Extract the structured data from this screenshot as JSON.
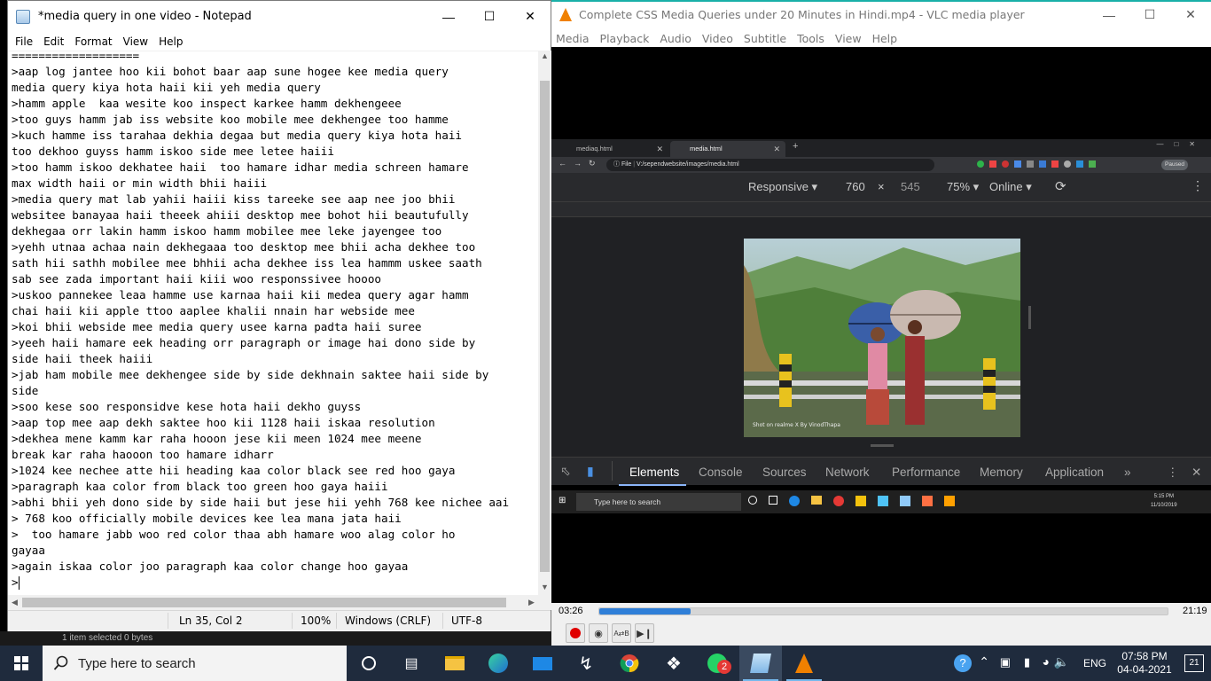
{
  "notepad": {
    "title": "*media query in one video - Notepad",
    "menu": [
      "File",
      "Edit",
      "Format",
      "View",
      "Help"
    ],
    "lines": [
      "===================",
      ">aap log jantee hoo kii bohot baar aap sune hogee kee media query",
      "media query kiya hota haii kii yeh media query",
      ">hamm apple  kaa wesite koo inspect karkee hamm dekhengeee",
      ">too guys hamm jab iss website koo mobile mee dekhengee too hamme",
      ">kuch hamme iss tarahaa dekhia degaa but media query kiya hota haii",
      "too dekhoo guyss hamm iskoo side mee letee haiii",
      ">too hamm iskoo dekhatee haii  too hamare idhar media schreen hamare",
      "max width haii or min width bhii haiii",
      ">media query mat lab yahii haiii kiss tareeke see aap nee joo bhii",
      "websitee banayaa haii theeek ahiii desktop mee bohot hii beautufully",
      "dekhegaa orr lakin hamm iskoo hamm mobilee mee leke jayengee too",
      ">yehh utnaa achaa nain dekhegaaa too desktop mee bhii acha dekhee too",
      "sath hii sathh mobilee mee bhhii acha dekhee iss lea hammm uskee saath",
      "sab see zada important haii kiii woo responssivee hoooo",
      ">uskoo pannekee leaa hamme use karnaa haii kii medea query agar hamm",
      "chai haii kii apple ttoo aaplee khalii nnain har webside mee",
      ">koi bhii webside mee media query usee karna padta haii suree",
      ">yeeh haii hamare eek heading orr paragraph or image hai dono side by",
      "side haii theek haiii",
      ">jab ham mobile mee dekhengee side by side dekhnain saktee haii side by",
      "side",
      ">soo kese soo responsidve kese hota haii dekho guyss",
      ">aap top mee aap dekh saktee hoo kii 1128 haii iskaa resolution",
      ">dekhea mene kamm kar raha hooon jese kii meen 1024 mee meene",
      "break kar raha haooon too hamare idharr",
      ">1024 kee nechee atte hii heading kaa color black see red hoo gaya",
      ">paragraph kaa color from black too green hoo gaya haiii",
      ">abhi bhii yeh dono side by side haii but jese hii yehh 768 kee nichee aai",
      "> 768 koo officially mobile devices kee lea mana jata haii",
      ">  too hamare jabb woo red color thaa abh hamare woo alag color ho",
      "gayaa",
      ">again iskaa color joo paragraph kaa color change hoo gayaa",
      ">"
    ],
    "status": {
      "position": "Ln 35, Col 2",
      "zoom": "100%",
      "line_ending": "Windows (CRLF)",
      "encoding": "UTF-8"
    }
  },
  "under_strip_text": "1 item selected  0 bytes",
  "vlc": {
    "title": "Complete CSS Media Queries under 20 Minutes in Hindi.mp4 - VLC media player",
    "menu": [
      "Media",
      "Playback",
      "Audio",
      "Video",
      "Subtitle",
      "Tools",
      "View",
      "Help"
    ],
    "elapsed": "03:26",
    "total": "21:19",
    "progress": 0.161,
    "accent": "#19b0a8"
  },
  "recording": {
    "tabs": [
      "mediaq.html",
      "media.html"
    ],
    "url_scheme": "File",
    "url": "V:/sependwebsite/images/media.html",
    "paused_label": "Paused",
    "device": "Responsive",
    "width": "760",
    "height": "545",
    "zoom": "75%",
    "network": "Online",
    "panel_tabs": [
      "Elements",
      "Console",
      "Sources",
      "Network",
      "Performance",
      "Memory",
      "Application"
    ],
    "more_tabs": "»",
    "taskbar_search": "Type here to search",
    "clock_time": "5:15 PM",
    "clock_date": "11/10/2019",
    "photo_caption": "Shot on realme X\nBy VinodThapa"
  },
  "taskbar": {
    "search_placeholder": "Type here to search",
    "language": "ENG",
    "time": "07:58 PM",
    "date": "04-04-2021",
    "whatsapp_badge": "2",
    "notifications": "21"
  }
}
